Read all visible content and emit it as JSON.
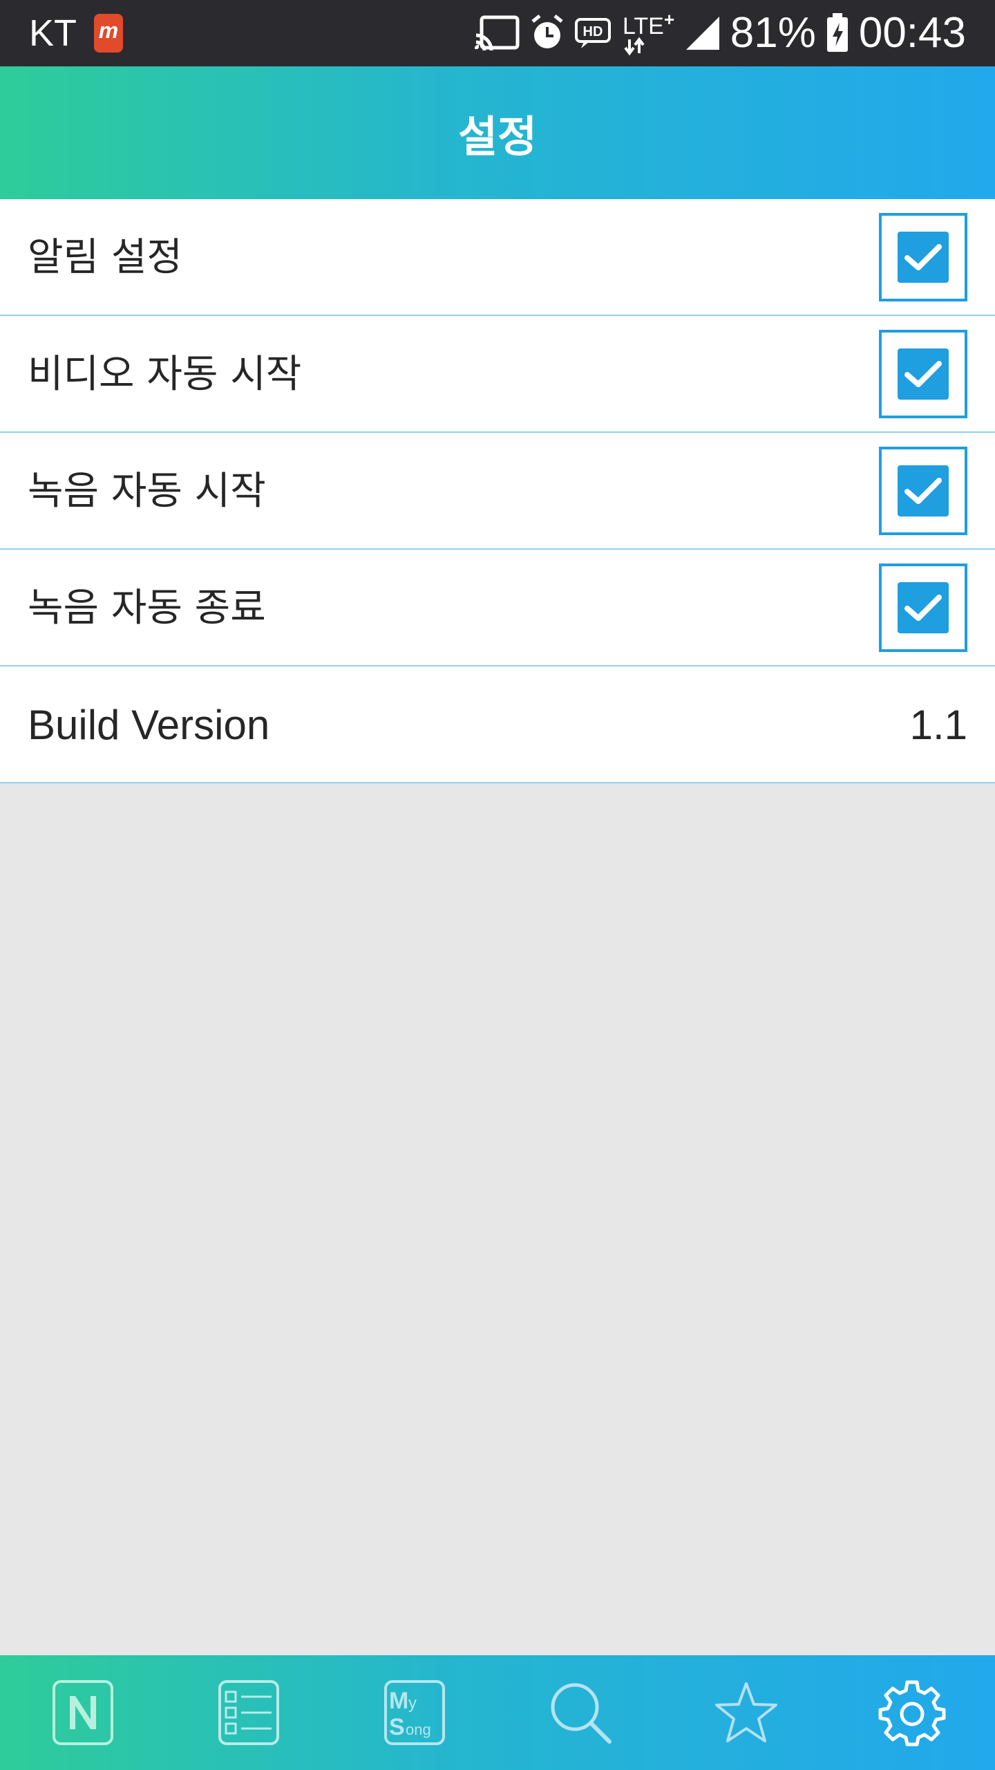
{
  "status_bar": {
    "carrier": "KT",
    "app_icon_letter": "m",
    "battery_percent": "81%",
    "time": "00:43",
    "icons": [
      "cast-icon",
      "alarm-icon",
      "hd-voice-icon",
      "lte-plus-icon",
      "signal-icon",
      "battery-charging-icon"
    ]
  },
  "header": {
    "title": "설정"
  },
  "settings": {
    "items": [
      {
        "label": "알림 설정",
        "checked": true
      },
      {
        "label": "비디오 자동 시작",
        "checked": true
      },
      {
        "label": "녹음 자동 시작",
        "checked": true
      },
      {
        "label": "녹음 자동 종료",
        "checked": true
      }
    ],
    "build": {
      "label": "Build Version",
      "value": "1.1"
    }
  },
  "bottom_nav": {
    "items": [
      {
        "icon": "new-n-icon",
        "mysong_text_m": "",
        "mysong_text_y": ""
      },
      {
        "icon": "list-icon"
      },
      {
        "icon": "mysong-icon",
        "text_my": "My",
        "text_song": "Song"
      },
      {
        "icon": "search-icon"
      },
      {
        "icon": "star-icon"
      },
      {
        "icon": "gear-icon"
      }
    ]
  },
  "colors": {
    "gradient_start": "#2ecc9a",
    "gradient_end": "#22a8ec",
    "checkbox_accent": "#1f9ee0",
    "divider": "#8fd2ec",
    "background": "#e7e7e8"
  }
}
